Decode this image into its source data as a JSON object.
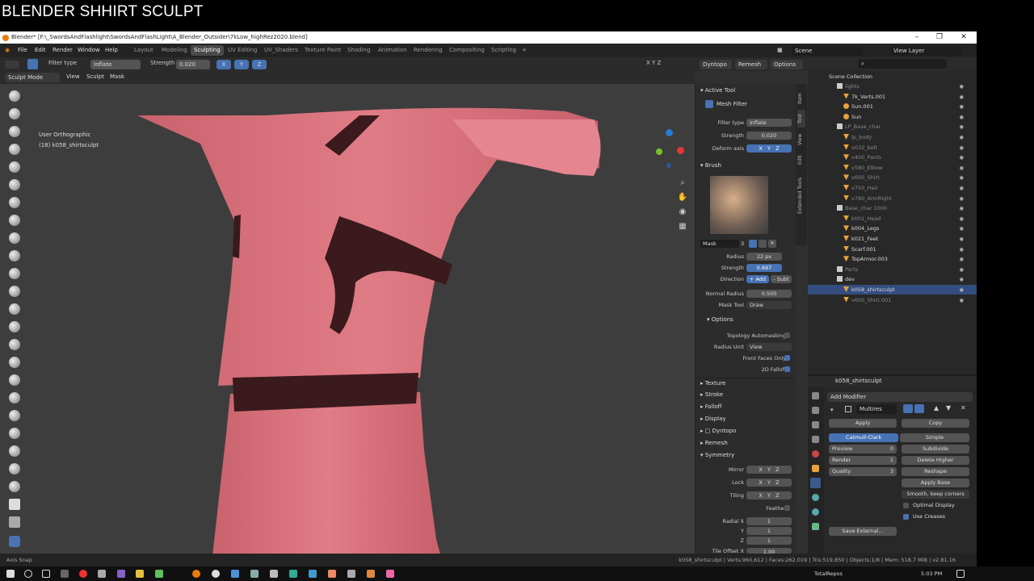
{
  "banner": {
    "title": "BLENDER SHHIRT SCULPT"
  },
  "window": {
    "title": "Blender* [F:\\_SwordsAndFlashlight\\SwordsAndFlashLight\\A_Blender_Outsider\\7kLow_highRez2020.blend]"
  },
  "menu": [
    "File",
    "Edit",
    "Render",
    "Window",
    "Help"
  ],
  "workspaces": [
    "Layout",
    "Modeling",
    "Sculpting",
    "UV Editing",
    "UV_Shaders",
    "Texture Paint",
    "Shading",
    "Animation",
    "Rendering",
    "Compositing",
    "Scripting"
  ],
  "active_workspace": "Sculpting",
  "scene": {
    "label": "Scene",
    "view_layer": "View Layer"
  },
  "tool_header": {
    "filter_type_label": "Filter type",
    "filter_type_value": "Inflate",
    "strength_label": "Strength",
    "strength_value": "0.020",
    "axes": [
      "X",
      "Y",
      "Z"
    ],
    "mirror_axes": "X Y Z",
    "dyntopo": "Dyntopo",
    "remesh": "Remesh",
    "options": "Options"
  },
  "view_header": {
    "mode": "Sculpt Mode",
    "items": [
      "View",
      "Sculpt",
      "Mask"
    ]
  },
  "viewport": {
    "view_name": "User Orthographic",
    "object_label": "(18) k058_shirtsculpt"
  },
  "npanel": {
    "active_tool_title": "Active Tool",
    "tool_name": "Mesh Filter",
    "filter_type_label": "Filter type",
    "filter_type_value": "Inflate",
    "strength_label": "Strength",
    "strength_value": "0.020",
    "deform_axis_label": "Deform axis",
    "brush_title": "Brush",
    "brush_name": "Mask",
    "brush_users": "3",
    "radius_label": "Radius",
    "radius_value": "22 px",
    "bstrength_label": "Strength",
    "bstrength_value": "0.697",
    "direction_label": "Direction",
    "direction_add": "+ Add",
    "direction_sub": "- Subt",
    "normal_radius_label": "Normal Radius",
    "normal_radius_value": "0.500",
    "mask_tool_label": "Mask Tool",
    "mask_tool_value": "Draw",
    "options_title": "Options",
    "topology_label": "Topology Automasking",
    "radius_unit_label": "Radius Unit",
    "radius_unit_value": "View",
    "front_faces_label": "Front Faces Only",
    "falloff2d_label": "2D Falloff",
    "collapsed": [
      "Texture",
      "Stroke",
      "Falloff",
      "Display",
      "Dyntopo",
      "Remesh"
    ],
    "symmetry_title": "Symmetry",
    "mirror_label": "Mirror",
    "lock_label": "Lock",
    "tiling_label": "Tiling",
    "feather_label": "Feather",
    "radial_x_label": "Radial X",
    "radial_y_label": "Y",
    "radial_z_label": "Z",
    "radial_x": "1",
    "radial_y": "1",
    "radial_z": "1",
    "tile_offset_label": "Tile Offset X",
    "tile_offset_value": "1.00"
  },
  "vtabs": [
    "Item",
    "Tool",
    "View",
    "Edit",
    "Extended Tools"
  ],
  "outliner": {
    "title": "Scene Collection",
    "rows": [
      {
        "name": "lights",
        "kind": "collection",
        "dim": true
      },
      {
        "name": "7k_Verts.001",
        "kind": "object",
        "dim": false
      },
      {
        "name": "Sun.001",
        "kind": "light",
        "dim": false
      },
      {
        "name": "Sun",
        "kind": "light",
        "dim": false
      },
      {
        "name": "LP_Base_char",
        "kind": "collection",
        "dim": true
      },
      {
        "name": "lp_body",
        "kind": "object",
        "dim": true
      },
      {
        "name": "v032_belt",
        "kind": "object",
        "dim": true
      },
      {
        "name": "v400_Pants",
        "kind": "object",
        "dim": true
      },
      {
        "name": "v580_Elbow",
        "kind": "object",
        "dim": true
      },
      {
        "name": "v600_Shirt",
        "kind": "object",
        "dim": true
      },
      {
        "name": "v750_Hair",
        "kind": "object",
        "dim": true
      },
      {
        "name": "v780_ArmRight",
        "kind": "object",
        "dim": true
      },
      {
        "name": "Base_char 1000",
        "kind": "collection",
        "dim": true
      },
      {
        "name": "k001_Head",
        "kind": "object",
        "dim": true
      },
      {
        "name": "k004_Legs",
        "kind": "object",
        "dim": false
      },
      {
        "name": "k021_Feet",
        "kind": "object",
        "dim": false
      },
      {
        "name": "Scarf.001",
        "kind": "object",
        "dim": false
      },
      {
        "name": "TopArmor.003",
        "kind": "object",
        "dim": false
      },
      {
        "name": "Parts",
        "kind": "collection",
        "dim": true
      },
      {
        "name": "dev",
        "kind": "collection",
        "dim": false
      },
      {
        "name": "k058_shirtsculpt",
        "kind": "object",
        "dim": false,
        "selected": true
      },
      {
        "name": "v600_Shirt.001",
        "kind": "object",
        "dim": true
      }
    ]
  },
  "properties": {
    "object_name": "k058_shirtsculpt",
    "add_modifier": "Add Modifier",
    "modifier_name": "Multires",
    "apply": "Apply",
    "copy": "Copy",
    "catmull": "Catmull-Clark",
    "simple": "Simple",
    "preview_label": "Preview",
    "preview_value": "0",
    "render_label": "Render",
    "render_value": "1",
    "quality_label": "Quality",
    "quality_value": "3",
    "subdivide": "Subdivide",
    "delete_higher": "Delete Higher",
    "reshape": "Reshape",
    "apply_base": "Apply Base",
    "smooth_mode": "Smooth, keep corners",
    "optimal_display": "Optimal Display",
    "use_creases": "Use Creases",
    "save_external": "Save External..."
  },
  "statusbar": {
    "left": "Axis Snap",
    "right": "k058_shirtsculpt | Verts:960,612 | Faces:262,019 | Tris:519,850 | Objects:1/8 | Mem: 518.7 MiB | v2.81.16"
  },
  "taskbar": {
    "tray_label": "TotalRepos",
    "time": "5:03 PM"
  },
  "colors": {
    "accent": "#4772b3",
    "cloth": "#d9707a",
    "belt": "#3a1a1c",
    "orange": "#e8a23c"
  }
}
